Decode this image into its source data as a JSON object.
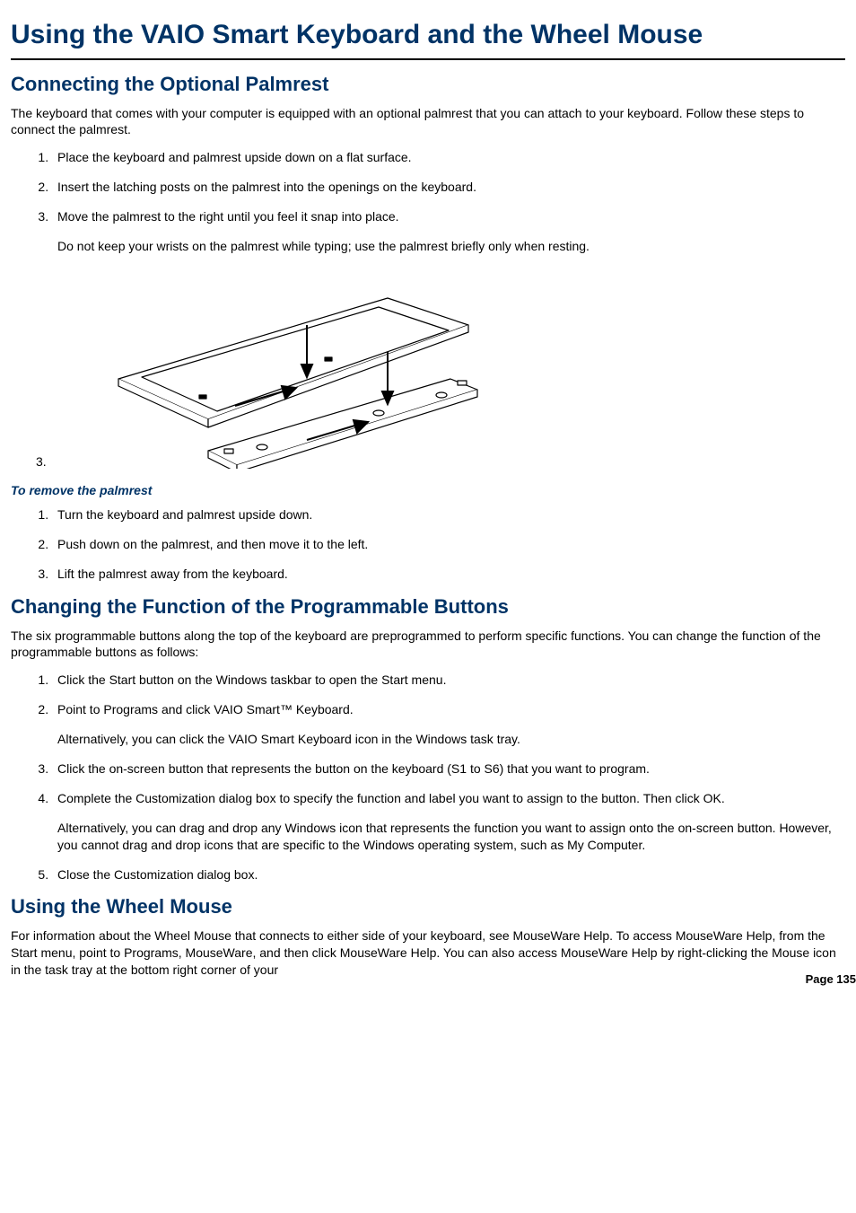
{
  "title": "Using the VAIO Smart Keyboard and the Wheel Mouse",
  "section1": {
    "heading": "Connecting the Optional Palmrest",
    "intro": "The keyboard that comes with your computer is equipped with an optional palmrest that you can attach to your keyboard. Follow these steps to connect the palmrest.",
    "steps": [
      "Place the keyboard and palmrest upside down on a flat surface.",
      "Insert the latching posts on the palmrest into the openings on the keyboard.",
      "Move the palmrest to the right until you feel it snap into place."
    ],
    "note_after_step3": "Do not keep your wrists on the palmrest while typing; use the palmrest briefly only when resting.",
    "lone_number": "3.",
    "remove_heading": "To remove the palmrest",
    "remove_steps": [
      "Turn the keyboard and palmrest upside down.",
      "Push down on the palmrest, and then move it to the left.",
      "Lift the palmrest away from the keyboard."
    ]
  },
  "section2": {
    "heading": "Changing the Function of the Programmable Buttons",
    "intro": "The six programmable buttons along the top of the keyboard are preprogrammed to perform specific functions. You can change the function of the programmable buttons as follows:",
    "steps": {
      "s1": "Click the Start button on the Windows taskbar to open the Start menu.",
      "s2": "Point to Programs and click VAIO Smart™ Keyboard.",
      "s2_alt": "Alternatively, you can click the VAIO Smart Keyboard icon in the Windows task tray.",
      "s3": "Click the on-screen button that represents the button on the keyboard (S1 to S6) that you want to program.",
      "s4": "Complete the Customization dialog box to specify the function and label you want to assign to the button. Then click OK.",
      "s4_alt": "Alternatively, you can drag and drop any Windows icon that represents the function you want to assign onto the on-screen button. However, you cannot drag and drop icons that are specific to the Windows operating system, such as My Computer.",
      "s5": "Close the Customization dialog box."
    }
  },
  "section3": {
    "heading": "Using the Wheel Mouse",
    "intro": "For information about the Wheel Mouse that connects to either side of your keyboard, see MouseWare Help. To access MouseWare Help, from the Start menu, point to Programs, MouseWare, and then click MouseWare Help. You can also access MouseWare Help by right-clicking the Mouse icon in the task tray at the bottom right corner of your"
  },
  "page_number": "Page 135"
}
